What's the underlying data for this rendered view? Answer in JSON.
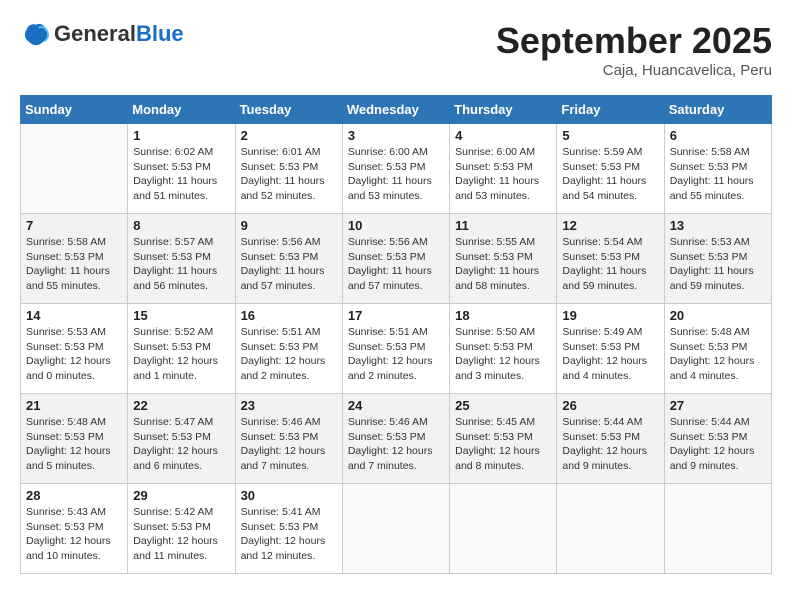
{
  "header": {
    "logo_general": "General",
    "logo_blue": "Blue",
    "month": "September 2025",
    "location": "Caja, Huancavelica, Peru"
  },
  "days_of_week": [
    "Sunday",
    "Monday",
    "Tuesday",
    "Wednesday",
    "Thursday",
    "Friday",
    "Saturday"
  ],
  "weeks": [
    [
      {
        "day": "",
        "info": ""
      },
      {
        "day": "1",
        "info": "Sunrise: 6:02 AM\nSunset: 5:53 PM\nDaylight: 11 hours\nand 51 minutes."
      },
      {
        "day": "2",
        "info": "Sunrise: 6:01 AM\nSunset: 5:53 PM\nDaylight: 11 hours\nand 52 minutes."
      },
      {
        "day": "3",
        "info": "Sunrise: 6:00 AM\nSunset: 5:53 PM\nDaylight: 11 hours\nand 53 minutes."
      },
      {
        "day": "4",
        "info": "Sunrise: 6:00 AM\nSunset: 5:53 PM\nDaylight: 11 hours\nand 53 minutes."
      },
      {
        "day": "5",
        "info": "Sunrise: 5:59 AM\nSunset: 5:53 PM\nDaylight: 11 hours\nand 54 minutes."
      },
      {
        "day": "6",
        "info": "Sunrise: 5:58 AM\nSunset: 5:53 PM\nDaylight: 11 hours\nand 55 minutes."
      }
    ],
    [
      {
        "day": "7",
        "info": "Sunrise: 5:58 AM\nSunset: 5:53 PM\nDaylight: 11 hours\nand 55 minutes."
      },
      {
        "day": "8",
        "info": "Sunrise: 5:57 AM\nSunset: 5:53 PM\nDaylight: 11 hours\nand 56 minutes."
      },
      {
        "day": "9",
        "info": "Sunrise: 5:56 AM\nSunset: 5:53 PM\nDaylight: 11 hours\nand 57 minutes."
      },
      {
        "day": "10",
        "info": "Sunrise: 5:56 AM\nSunset: 5:53 PM\nDaylight: 11 hours\nand 57 minutes."
      },
      {
        "day": "11",
        "info": "Sunrise: 5:55 AM\nSunset: 5:53 PM\nDaylight: 11 hours\nand 58 minutes."
      },
      {
        "day": "12",
        "info": "Sunrise: 5:54 AM\nSunset: 5:53 PM\nDaylight: 11 hours\nand 59 minutes."
      },
      {
        "day": "13",
        "info": "Sunrise: 5:53 AM\nSunset: 5:53 PM\nDaylight: 11 hours\nand 59 minutes."
      }
    ],
    [
      {
        "day": "14",
        "info": "Sunrise: 5:53 AM\nSunset: 5:53 PM\nDaylight: 12 hours\nand 0 minutes."
      },
      {
        "day": "15",
        "info": "Sunrise: 5:52 AM\nSunset: 5:53 PM\nDaylight: 12 hours\nand 1 minute."
      },
      {
        "day": "16",
        "info": "Sunrise: 5:51 AM\nSunset: 5:53 PM\nDaylight: 12 hours\nand 2 minutes."
      },
      {
        "day": "17",
        "info": "Sunrise: 5:51 AM\nSunset: 5:53 PM\nDaylight: 12 hours\nand 2 minutes."
      },
      {
        "day": "18",
        "info": "Sunrise: 5:50 AM\nSunset: 5:53 PM\nDaylight: 12 hours\nand 3 minutes."
      },
      {
        "day": "19",
        "info": "Sunrise: 5:49 AM\nSunset: 5:53 PM\nDaylight: 12 hours\nand 4 minutes."
      },
      {
        "day": "20",
        "info": "Sunrise: 5:48 AM\nSunset: 5:53 PM\nDaylight: 12 hours\nand 4 minutes."
      }
    ],
    [
      {
        "day": "21",
        "info": "Sunrise: 5:48 AM\nSunset: 5:53 PM\nDaylight: 12 hours\nand 5 minutes."
      },
      {
        "day": "22",
        "info": "Sunrise: 5:47 AM\nSunset: 5:53 PM\nDaylight: 12 hours\nand 6 minutes."
      },
      {
        "day": "23",
        "info": "Sunrise: 5:46 AM\nSunset: 5:53 PM\nDaylight: 12 hours\nand 7 minutes."
      },
      {
        "day": "24",
        "info": "Sunrise: 5:46 AM\nSunset: 5:53 PM\nDaylight: 12 hours\nand 7 minutes."
      },
      {
        "day": "25",
        "info": "Sunrise: 5:45 AM\nSunset: 5:53 PM\nDaylight: 12 hours\nand 8 minutes."
      },
      {
        "day": "26",
        "info": "Sunrise: 5:44 AM\nSunset: 5:53 PM\nDaylight: 12 hours\nand 9 minutes."
      },
      {
        "day": "27",
        "info": "Sunrise: 5:44 AM\nSunset: 5:53 PM\nDaylight: 12 hours\nand 9 minutes."
      }
    ],
    [
      {
        "day": "28",
        "info": "Sunrise: 5:43 AM\nSunset: 5:53 PM\nDaylight: 12 hours\nand 10 minutes."
      },
      {
        "day": "29",
        "info": "Sunrise: 5:42 AM\nSunset: 5:53 PM\nDaylight: 12 hours\nand 11 minutes."
      },
      {
        "day": "30",
        "info": "Sunrise: 5:41 AM\nSunset: 5:53 PM\nDaylight: 12 hours\nand 12 minutes."
      },
      {
        "day": "",
        "info": ""
      },
      {
        "day": "",
        "info": ""
      },
      {
        "day": "",
        "info": ""
      },
      {
        "day": "",
        "info": ""
      }
    ]
  ]
}
